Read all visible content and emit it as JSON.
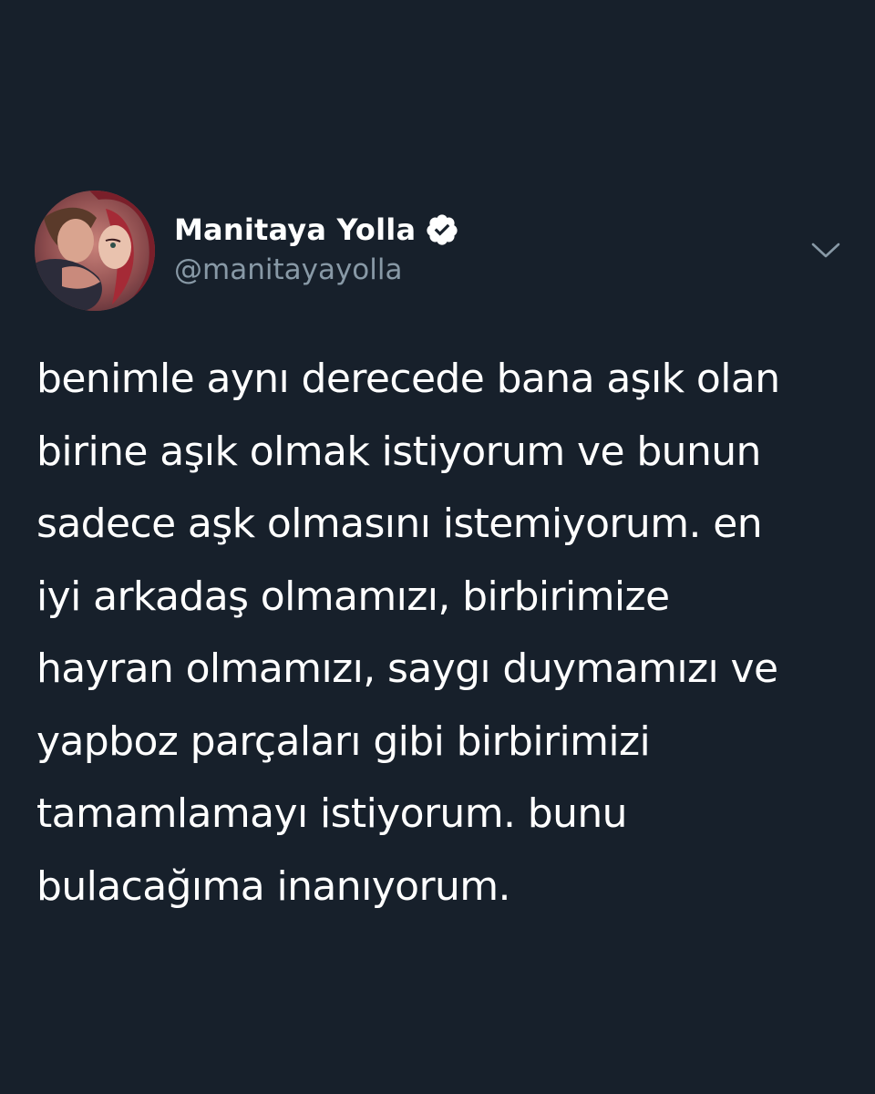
{
  "author": {
    "display_name": "Manitaya Yolla",
    "handle": "@manitayayolla",
    "verified": true
  },
  "tweet": {
    "lines": [
      "benimle aynı derecede bana aşık olan",
      "birine aşık olmak istiyorum ve bunun",
      "sadece aşk olmasını istemiyorum. en",
      "iyi arkadaş olmamızı, birbirimize",
      "hayran olmamızı, saygı duymamızı ve",
      "yapboz parçaları gibi birbirimizi",
      "tamamlamayı istiyorum. bunu",
      "bulacağıma inanıyorum."
    ]
  },
  "colors": {
    "background": "#17202b",
    "text_primary": "#ffffff",
    "text_secondary": "#8899a6"
  },
  "icons": {
    "verified": "verified-badge-icon",
    "menu": "chevron-down-icon"
  }
}
